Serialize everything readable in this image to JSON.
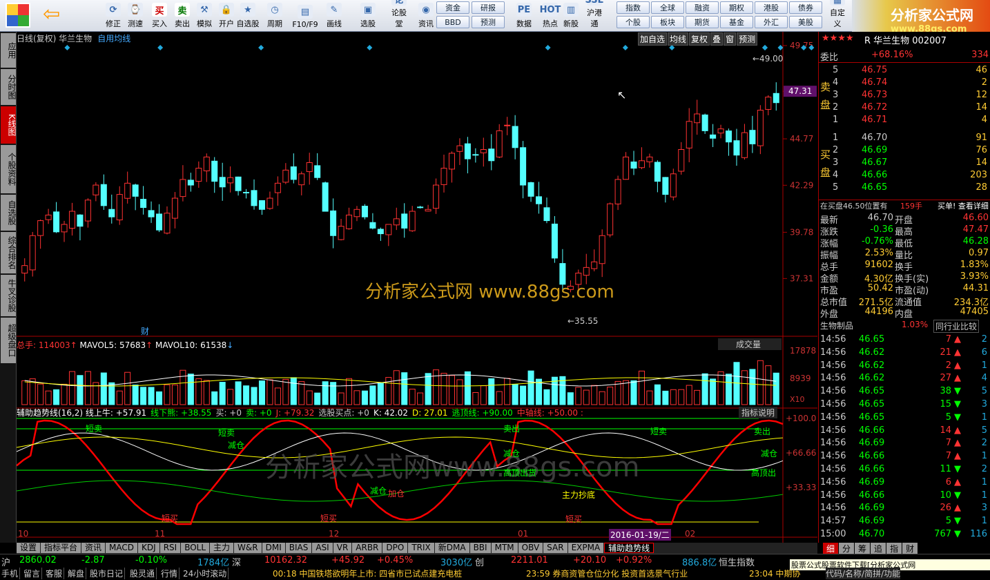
{
  "toolbar": {
    "buttons": [
      "修正",
      "测速",
      "买入",
      "卖出",
      "模拟",
      "开户",
      "自选股",
      "周期",
      "F10/F9",
      "画线",
      "选股",
      "论股堂",
      "资讯",
      "数据",
      "热点",
      "新股",
      "沪港通",
      "自定义"
    ],
    "grid1": [
      "资金",
      "研报",
      "BBD",
      "预测"
    ],
    "grid2": [
      "指数",
      "全球",
      "融资",
      "期权",
      "港股",
      "债券",
      "个股",
      "板块",
      "期货",
      "基金",
      "外汇",
      "美股"
    ]
  },
  "logo": {
    "line1": "分析家公式网",
    "line2": "www.88gs.com"
  },
  "left_tabs": [
    "应用",
    "分时图",
    "K线图",
    "个股资料",
    "自选股",
    "综合排名",
    "牛叉诊股",
    "超级盘口"
  ],
  "main": {
    "header_left": "日线(复权) 华兰生物",
    "header_avg": "自用均线",
    "header_right": [
      "加自选",
      "均线",
      "复权",
      "叠",
      "窗",
      "预测"
    ],
    "price_axis": [
      "49.75",
      "47.31",
      "44.77",
      "42.29",
      "39.78",
      "37.31"
    ],
    "max_label": "49.00",
    "min_label": "35.55",
    "cai": "财",
    "watermark1": "分析家公式网 www.88gs.com",
    "watermark2": "分析家公式网www.88gs.com",
    "cur_price": "47.31"
  },
  "volume": {
    "label_total": "总手: 114003",
    "label_ma5": "MAVOL5: 57683",
    "label_ma10": "MAVOL10: 61538",
    "selector": "成交量",
    "axis": [
      "17878",
      "8939",
      "X10"
    ]
  },
  "indicator": {
    "title": "辅助趋势线(16,2) 线上牛: +57.91",
    "f2": "线下熊: +38.55",
    "f3": "买: +0",
    "f4": "卖: +0",
    "f5": "J: +79.32",
    "f6": "选股买点: +0",
    "f7": "K: 42.02",
    "f8": "D: 27.01",
    "f9": "逃顶线: +90.00",
    "f10": "中轴线: +50.00 :",
    "help": "指标说明",
    "axis": [
      "+100.0",
      "+66.66",
      "+33.33"
    ],
    "labels": [
      "短卖",
      "短卖",
      "减仓",
      "短买",
      "短买",
      "减仓",
      "加仓",
      "卖出",
      "减仓",
      "高顶出货",
      "主力抄底",
      "短买",
      "短卖",
      "卖出",
      "减仓",
      "高顶出"
    ]
  },
  "dates": [
    "10",
    "11",
    "12",
    "01",
    "02"
  ],
  "date_sel": "2016-01-19/二",
  "bottom_tabs": [
    "设置",
    "指标平台",
    "资讯",
    "MACD",
    "KDJ",
    "RSI",
    "BOLL",
    "主力",
    "W&R",
    "DMI",
    "BIAS",
    "ASI",
    "VR",
    "ARBR",
    "DPO",
    "TRIX",
    "新DMA",
    "BBI",
    "MTM",
    "OBV",
    "SAR",
    "EXPMA",
    "辅助趋势线"
  ],
  "right": {
    "title": "R 华兰生物 002007",
    "weibi_label": "委比",
    "weibi": "+68.16%",
    "weicha": "334",
    "sell": [
      [
        "5",
        "46.75",
        "46"
      ],
      [
        "4",
        "46.74",
        "2"
      ],
      [
        "3",
        "46.73",
        "12"
      ],
      [
        "2",
        "46.72",
        "14"
      ],
      [
        "1",
        "46.71",
        "4"
      ]
    ],
    "buy": [
      [
        "1",
        "46.70",
        "91"
      ],
      [
        "2",
        "46.69",
        "76"
      ],
      [
        "3",
        "46.67",
        "14"
      ],
      [
        "4",
        "46.66",
        "203"
      ],
      [
        "5",
        "46.65",
        "28"
      ]
    ],
    "sell_label": "卖盘",
    "buy_label": "买盘",
    "notice": "在买盘46.50位置有",
    "notice_vol": "159手",
    "notice_act": "买单! 查看详细",
    "quote": [
      [
        "最新",
        "46.70",
        "开盘",
        "46.60"
      ],
      [
        "涨跌",
        "-0.36",
        "最高",
        "47.47"
      ],
      [
        "涨幅",
        "-0.76%",
        "最低",
        "46.28"
      ],
      [
        "振幅",
        "2.53%",
        "量比",
        "0.97"
      ],
      [
        "总手",
        "91602",
        "换手",
        "1.83%"
      ],
      [
        "金额",
        "4.30亿",
        "换手(实)",
        "3.93%"
      ],
      [
        "市盈",
        "50.42",
        "市盈(动)",
        "44.31"
      ],
      [
        "总市值",
        "271.5亿",
        "流通值",
        "234.3亿"
      ],
      [
        "外盘",
        "44196",
        "内盘",
        "47405"
      ]
    ],
    "sector": "生物制品",
    "sector_pct": "1.03%",
    "sector_btn": "同行业比较",
    "ticks": [
      [
        "14:56",
        "46.65",
        "7",
        "2"
      ],
      [
        "14:56",
        "46.62",
        "21",
        "6"
      ],
      [
        "14:56",
        "46.62",
        "2",
        "1"
      ],
      [
        "14:56",
        "46.62",
        "27",
        "4"
      ],
      [
        "14:56",
        "46.65",
        "38",
        "5"
      ],
      [
        "14:56",
        "46.65",
        "15",
        "3"
      ],
      [
        "14:56",
        "46.65",
        "5",
        "1"
      ],
      [
        "14:56",
        "46.66",
        "14",
        "5"
      ],
      [
        "14:56",
        "46.69",
        "7",
        "2"
      ],
      [
        "14:56",
        "46.66",
        "7",
        "1"
      ],
      [
        "14:56",
        "46.66",
        "11",
        "2"
      ],
      [
        "14:56",
        "46.69",
        "6",
        "1"
      ],
      [
        "14:56",
        "46.66",
        "10",
        "1"
      ],
      [
        "14:56",
        "46.69",
        "26",
        "3"
      ],
      [
        "14:57",
        "46.69",
        "5",
        "1"
      ],
      [
        "15:00",
        "46.70",
        "767",
        "116"
      ]
    ],
    "tabs": [
      "细",
      "分",
      "筹",
      "追",
      "指",
      "财"
    ]
  },
  "status": {
    "sh": "沪",
    "sh_idx": "2860.02",
    "sh_chg": "-2.87",
    "sh_pct": "-0.10%",
    "sh_amt": "1784亿",
    "sz": "深",
    "sz_idx": "10162.32",
    "sz_chg": "+45.92",
    "sz_pct": "+0.45%",
    "sz_amt": "3030亿",
    "cy": "创",
    "cy_idx": "2211.01",
    "cy_chg": "+20.10",
    "cy_pct": "+0.92%",
    "cy_amt": "886.8亿",
    "hk": "恒生指数",
    "ad": "股票公式股票软件下载[分析家公式网",
    "links": [
      "手机",
      "留言",
      "客服",
      "解盘",
      "股市日记",
      "股灵通",
      "行情",
      "24小时滚动"
    ],
    "news1": "00:18 中国铁塔欲明年上市: 四省市已试点建充电桩",
    "news2": "23:59 券商资管仓位分化 投资首选景气行业",
    "news3": "23:04 中期协",
    "tail": "代码/名称/简拼/功能"
  }
}
